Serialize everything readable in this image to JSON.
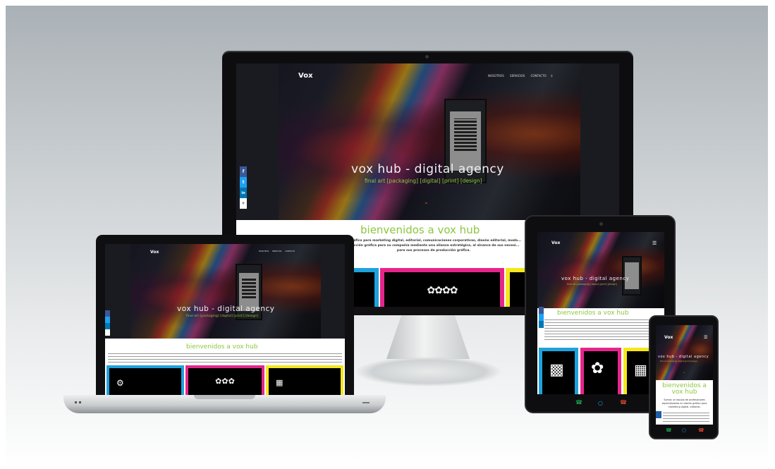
{
  "site": {
    "brand": "Vox",
    "nav": [
      "NOSOTROS",
      "SERVICIOS",
      "CONTACTO"
    ],
    "hero_title": "vox hub - digital agency",
    "hero_subtitle": "final art [packaging] [digital] [print] [design]",
    "welcome_title": "bienvenidos a vox hub",
    "welcome_text_desktop": [
      "...gráfico para marketing digital, editorial, comunicaciones corporativas, diseño editorial, moda...",
      "...ucción gráfica para su compañía mediante una alianza estratégica, al alcance de sus necesi...",
      "para sus procesos de producción gráfica."
    ],
    "welcome_text_phone": [
      "Somos un equipo de profesionales",
      "especializados en diseño gráfico para",
      "marketing digital, editorial,"
    ],
    "social": [
      "f",
      "t",
      "in",
      "+"
    ]
  },
  "colors": {
    "cyan": "#1fa2dc",
    "magenta": "#e6258c",
    "yellow": "#f4e71c",
    "green": "#8cc63e"
  },
  "icons": {
    "tile1": "robot-hands-icon",
    "tile2": "circuit-chip-icon",
    "tile3": "printer-icon"
  }
}
